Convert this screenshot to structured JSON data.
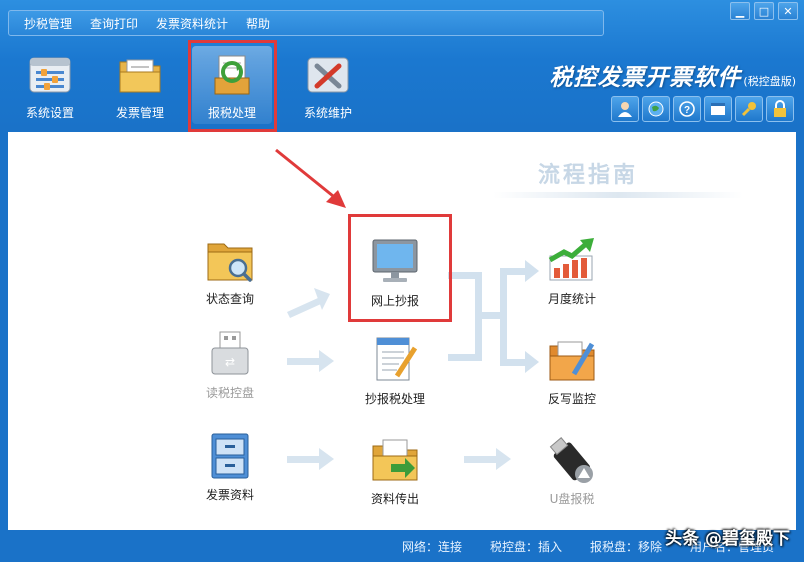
{
  "menubar": {
    "items": [
      "抄税管理",
      "查询打印",
      "发票资料统计",
      "帮助"
    ]
  },
  "toolbar": {
    "items": [
      {
        "label": "系统设置",
        "icon": "settings-panel-icon"
      },
      {
        "label": "发票管理",
        "icon": "folder-documents-icon"
      },
      {
        "label": "报税处理",
        "icon": "tax-report-icon"
      },
      {
        "label": "系统维护",
        "icon": "tools-icon"
      }
    ],
    "active_index": 2
  },
  "brand": {
    "title": "税控发票开票软件",
    "subtitle": "(税控盘版)"
  },
  "guide": {
    "title": "流程指南"
  },
  "flow": {
    "status_query": "状态查询",
    "read_disk": "读税控盘",
    "invoice_data": "发票资料",
    "online_report": "网上抄报",
    "copy_tax": "抄报税处理",
    "data_transfer": "资料传出",
    "monthly_stats": "月度统计",
    "writeback": "反写监控",
    "usb_report": "U盘报税"
  },
  "status": {
    "network": "网络：连接",
    "tax_disk": "税控盘：插入",
    "report_disk": "报税盘：移除",
    "user": "用户名：管理员"
  },
  "watermark": "头条 @碧玺殿下",
  "colors": {
    "window_blue": "#1b78d0",
    "highlight_red": "#e03a3a",
    "arrow_blue": "#c9dcec"
  }
}
